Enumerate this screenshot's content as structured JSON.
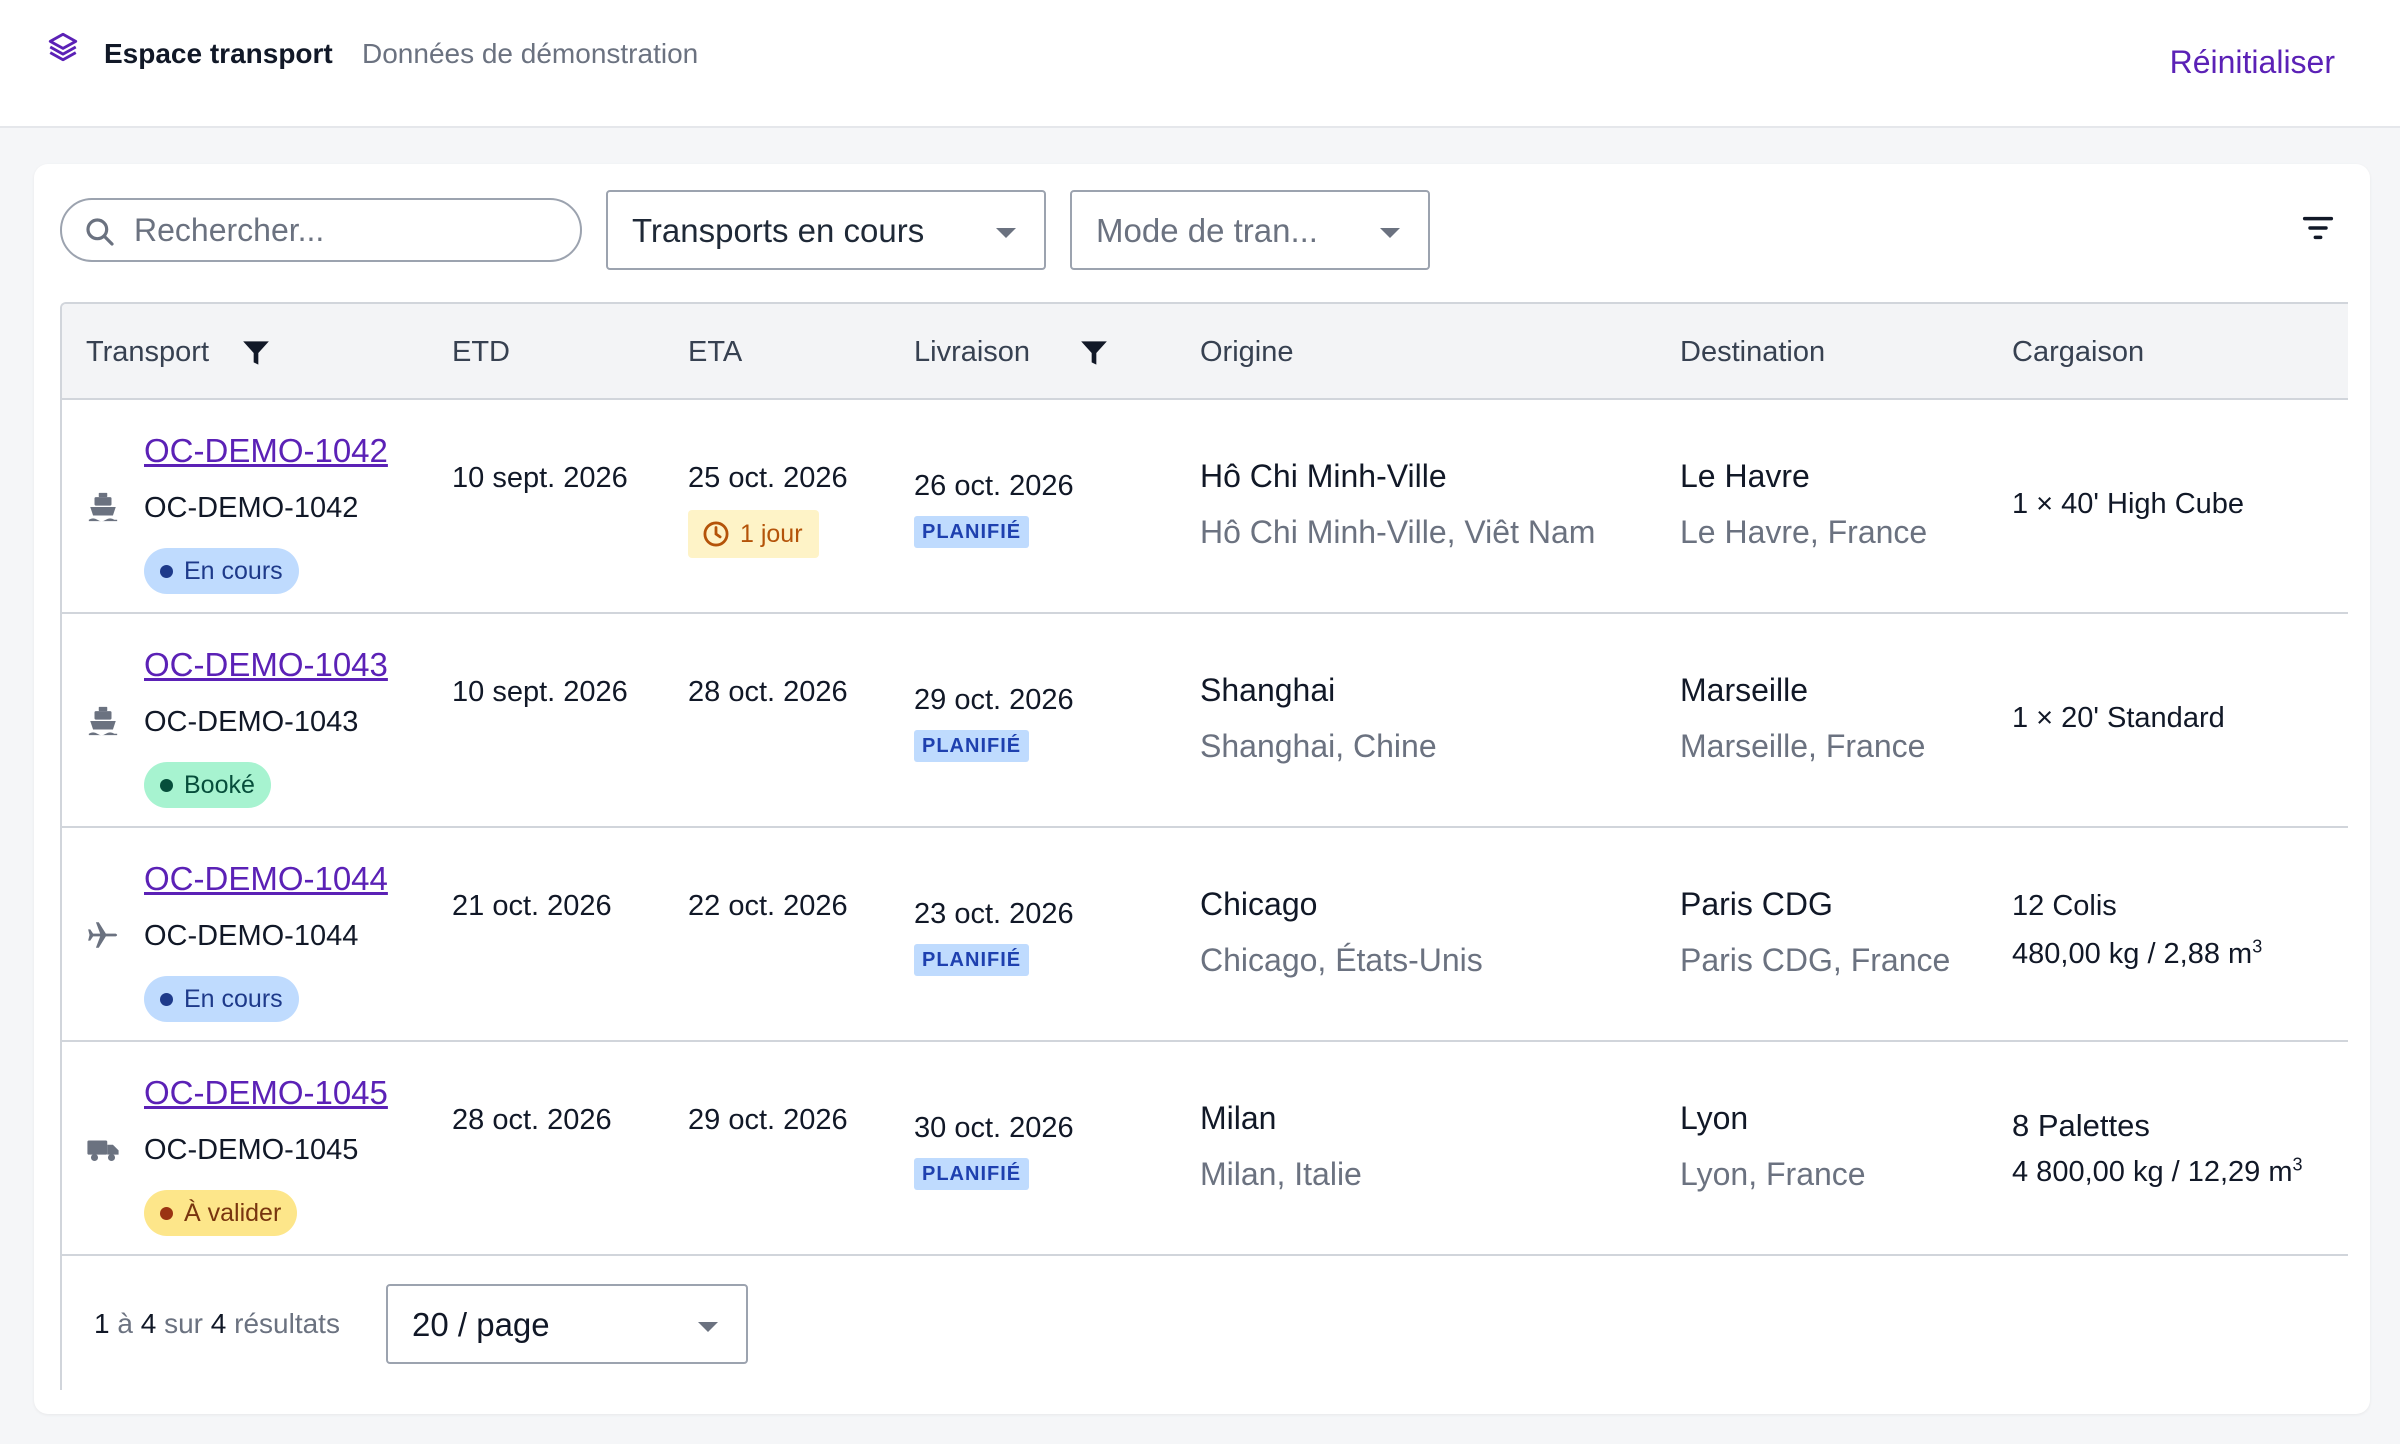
{
  "header": {
    "title": "Espace transport",
    "subtitle": "Données de démonstration",
    "reset_label": "Réinitialiser"
  },
  "toolbar": {
    "search_placeholder": "Rechercher...",
    "status_select": "Transports en cours",
    "mode_select_placeholder": "Mode de tran..."
  },
  "table": {
    "columns": {
      "transport": "Transport",
      "etd": "ETD",
      "eta": "ETA",
      "delivery": "Livraison",
      "origin": "Origine",
      "destination": "Destination",
      "cargo": "Cargaison"
    },
    "rows": [
      {
        "mode_icon": "ship-icon",
        "ref": "OC-DEMO-1042",
        "ref_sub": "OC-DEMO-1042",
        "status": "En cours",
        "etd": "10 sept. 2026",
        "eta": "25 oct. 2026",
        "delay": "1 jour",
        "delivery": "26 oct. 2026",
        "delivery_status": "PLANIFIÉ",
        "origin_city": "Hô Chi Minh-Ville",
        "origin_full": "Hô Chi Minh-Ville, Viêt Nam",
        "dest_city": "Le Havre",
        "dest_full": "Le Havre, France",
        "cargo_line1": "1 × 40' High Cube",
        "cargo_line2": ""
      },
      {
        "mode_icon": "ship-icon",
        "ref": "OC-DEMO-1043",
        "ref_sub": "OC-DEMO-1043",
        "status": "Booké",
        "etd": "10 sept. 2026",
        "eta": "28 oct. 2026",
        "delay": "",
        "delivery": "29 oct. 2026",
        "delivery_status": "PLANIFIÉ",
        "origin_city": "Shanghai",
        "origin_full": "Shanghai, Chine",
        "dest_city": "Marseille",
        "dest_full": "Marseille, France",
        "cargo_line1": "1 × 20' Standard",
        "cargo_line2": ""
      },
      {
        "mode_icon": "plane-icon",
        "ref": "OC-DEMO-1044",
        "ref_sub": "OC-DEMO-1044",
        "status": "En cours",
        "etd": "21 oct. 2026",
        "eta": "22 oct. 2026",
        "delay": "",
        "delivery": "23 oct. 2026",
        "delivery_status": "PLANIFIÉ",
        "origin_city": "Chicago",
        "origin_full": "Chicago, États-Unis",
        "dest_city": "Paris CDG",
        "dest_full": "Paris CDG, France",
        "cargo_line1": "12 Colis",
        "cargo_line2": "480,00 kg / 2,88 m",
        "cargo_unit_exp": "3"
      },
      {
        "mode_icon": "truck-icon",
        "ref": "OC-DEMO-1045",
        "ref_sub": "OC-DEMO-1045",
        "status": "À valider",
        "etd": "28 oct. 2026",
        "eta": "29 oct. 2026",
        "delay": "",
        "delivery": "30 oct. 2026",
        "delivery_status": "PLANIFIÉ",
        "origin_city": "Milan",
        "origin_full": "Milan, Italie",
        "dest_city": "Lyon",
        "dest_full": "Lyon, France",
        "cargo_line1": "8 Palettes",
        "cargo_line2": "4 800,00 kg / 12,29 m",
        "cargo_unit_exp": "3"
      }
    ]
  },
  "pagination": {
    "from": "1",
    "to": "4",
    "total": "4",
    "word_to": "à",
    "word_of": "sur",
    "word_results": "résultats",
    "page_size": "20 / page"
  },
  "colors": {
    "accent": "#5b21b6",
    "badge_blue": "#bfdbfe",
    "badge_green": "#a7f3d0",
    "badge_yellow": "#fde68a"
  }
}
